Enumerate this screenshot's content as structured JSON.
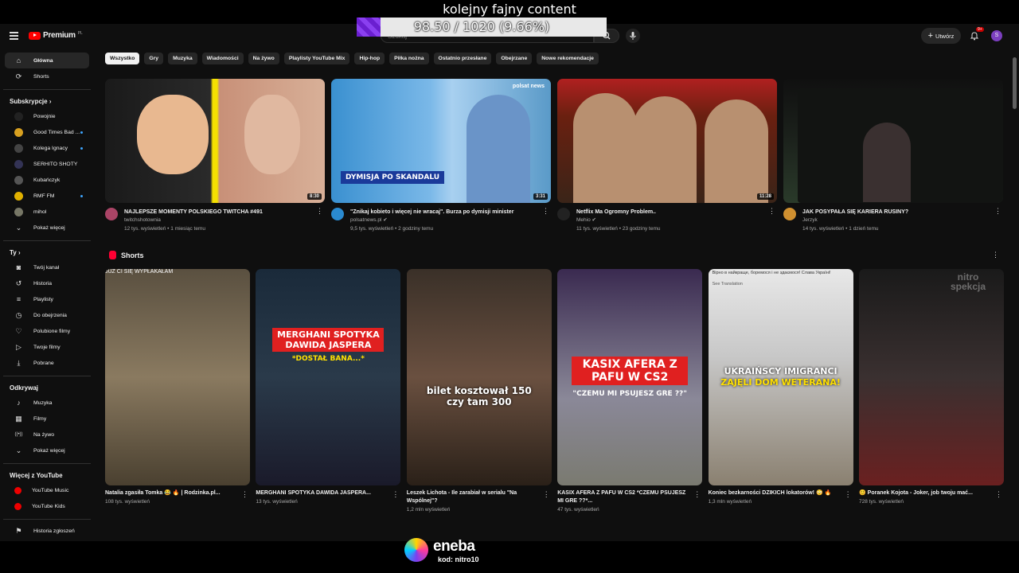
{
  "stream_overlay": {
    "title": "kolejny fajny content",
    "goal_text": "98.50 / 1020 (9.66%)",
    "goal_fraction": 0.0966,
    "sponsor_name": "eneba",
    "sponsor_code": "kod: nitro10"
  },
  "header": {
    "logo_text": "Premium",
    "logo_badge": "PL",
    "search_placeholder": "Szukaj",
    "create_label": "Utwórz",
    "notif_count": "9+",
    "avatar_letter": "S"
  },
  "sidebar": {
    "main": [
      {
        "label": "Główna",
        "icon": "home-icon",
        "active": true
      },
      {
        "label": "Shorts",
        "icon": "shorts-icon"
      }
    ],
    "subs_title": "Subskrypcje",
    "subs": [
      {
        "label": "Powojnie",
        "color": "#222"
      },
      {
        "label": "Good Times Bad ...",
        "color": "#d8a020"
      },
      {
        "label": "Kolega Ignacy",
        "color": "#444"
      },
      {
        "label": "SERHITO SHOTY",
        "color": "#335"
      },
      {
        "label": "Kubańczyk",
        "color": "#555"
      },
      {
        "label": "RMF FM",
        "color": "#e0b000"
      },
      {
        "label": "mihol",
        "color": "#776"
      }
    ],
    "subs_more": "Pokaż więcej",
    "you_title": "Ty",
    "you": [
      "Twój kanał",
      "Historia",
      "Playlisty",
      "Do obejrzenia",
      "Polubione filmy",
      "Twoje filmy",
      "Pobrane"
    ],
    "explore_title": "Odkrywaj",
    "explore": [
      "Muzyka",
      "Filmy",
      "Na żywo",
      "Pokaż więcej"
    ],
    "more_title": "Więcej z YouTube",
    "more": [
      "YouTube Music",
      "YouTube Kids"
    ],
    "report": "Historia zgłoszeń"
  },
  "chips": [
    "Wszystko",
    "Gry",
    "Muzyka",
    "Wiadomości",
    "Na żywo",
    "Playlisty YouTube Mix",
    "Hip-hop",
    "Piłka nożna",
    "Ostatnio przesłane",
    "Obejrzane",
    "Nowe rekomendacje"
  ],
  "videos": [
    {
      "title": "NAJLEPSZE MOMENTY POLSKIEGO TWITCHA #491",
      "channel": "twitchshotownia",
      "meta": "12 tys. wyświetleń • 1 miesiąc temu",
      "duration": "8:30",
      "avatar_color": "#aa4466"
    },
    {
      "title": "\"Znikaj kobieto i więcej nie wracaj\". Burza po dymisji minister",
      "channel": "polsatnews.pl ✔",
      "meta": "9,5 tys. wyświetleń • 2 godziny temu",
      "duration": "3:31",
      "avatar_color": "#2a8ad0",
      "overlay": "DYMISJA PO SKANDALU",
      "brand": "polsat news"
    },
    {
      "title": "Netflix Ma Ogromny Problem..",
      "channel": "Mehio ✔",
      "meta": "11 tys. wyświetleń • 23 godziny temu",
      "duration": "11:28",
      "avatar_color": "#222"
    },
    {
      "title": "JAK POSYPAŁA SIĘ KARIERA RUSINY?",
      "channel": "Jerzyk",
      "meta": "14 tys. wyświetleń • 1 dzień temu",
      "duration": "",
      "avatar_color": "#d09030"
    }
  ],
  "shorts_title": "Shorts",
  "shorts": [
    {
      "title": "Natalia zgasiła Tomka 😂 🔥 | Rodzinka.pl...",
      "views": "108 tys. wyświetleń",
      "overlay": "JUŻ CI SIĘ WYPŁAKAŁAM"
    },
    {
      "title": "MERGHANI SPOTYKA DAWIDA JASPERA...",
      "views": "13 tys. wyświetleń",
      "overlay": "MERGHANI SPOTYKA DAWIDA JASPERA",
      "overlay2": "*DOSTAŁ BANA...*"
    },
    {
      "title": "Leszek Lichota - Ile zarabiał w serialu \"Na Wspólnej\"?",
      "views": "1,2 mln wyświetleń",
      "overlay": "bilet kosztował 150 czy tam 300"
    },
    {
      "title": "KASIX AFERA Z PAFU W CS2 *CZEMU PSUJESZ MI GRE ??*...",
      "views": "47 tys. wyświetleń",
      "overlay": "KASIX AFERA Z PAFU W CS2",
      "overlay2": "\"CZEMU MI PSUJESZ GRE ??\""
    },
    {
      "title": "Koniec bezkarności DZIKICH lokatorów! 😳 🔥",
      "views": "1,3 mln wyświetleń",
      "overlay": "UKRAIŃSCY IMIGRANCI",
      "overlay2": "ZAJĘLI DOM WETERANA!",
      "caption": "Вірно в найкраще, боремося і не здаємося! Слава Україні!",
      "translate": "See Translation"
    },
    {
      "title": "😊 Poranek Kojota - Joker, job twoju mać...",
      "views": "728 tys. wyświetleń",
      "watermark": "nitro spekcja"
    }
  ]
}
